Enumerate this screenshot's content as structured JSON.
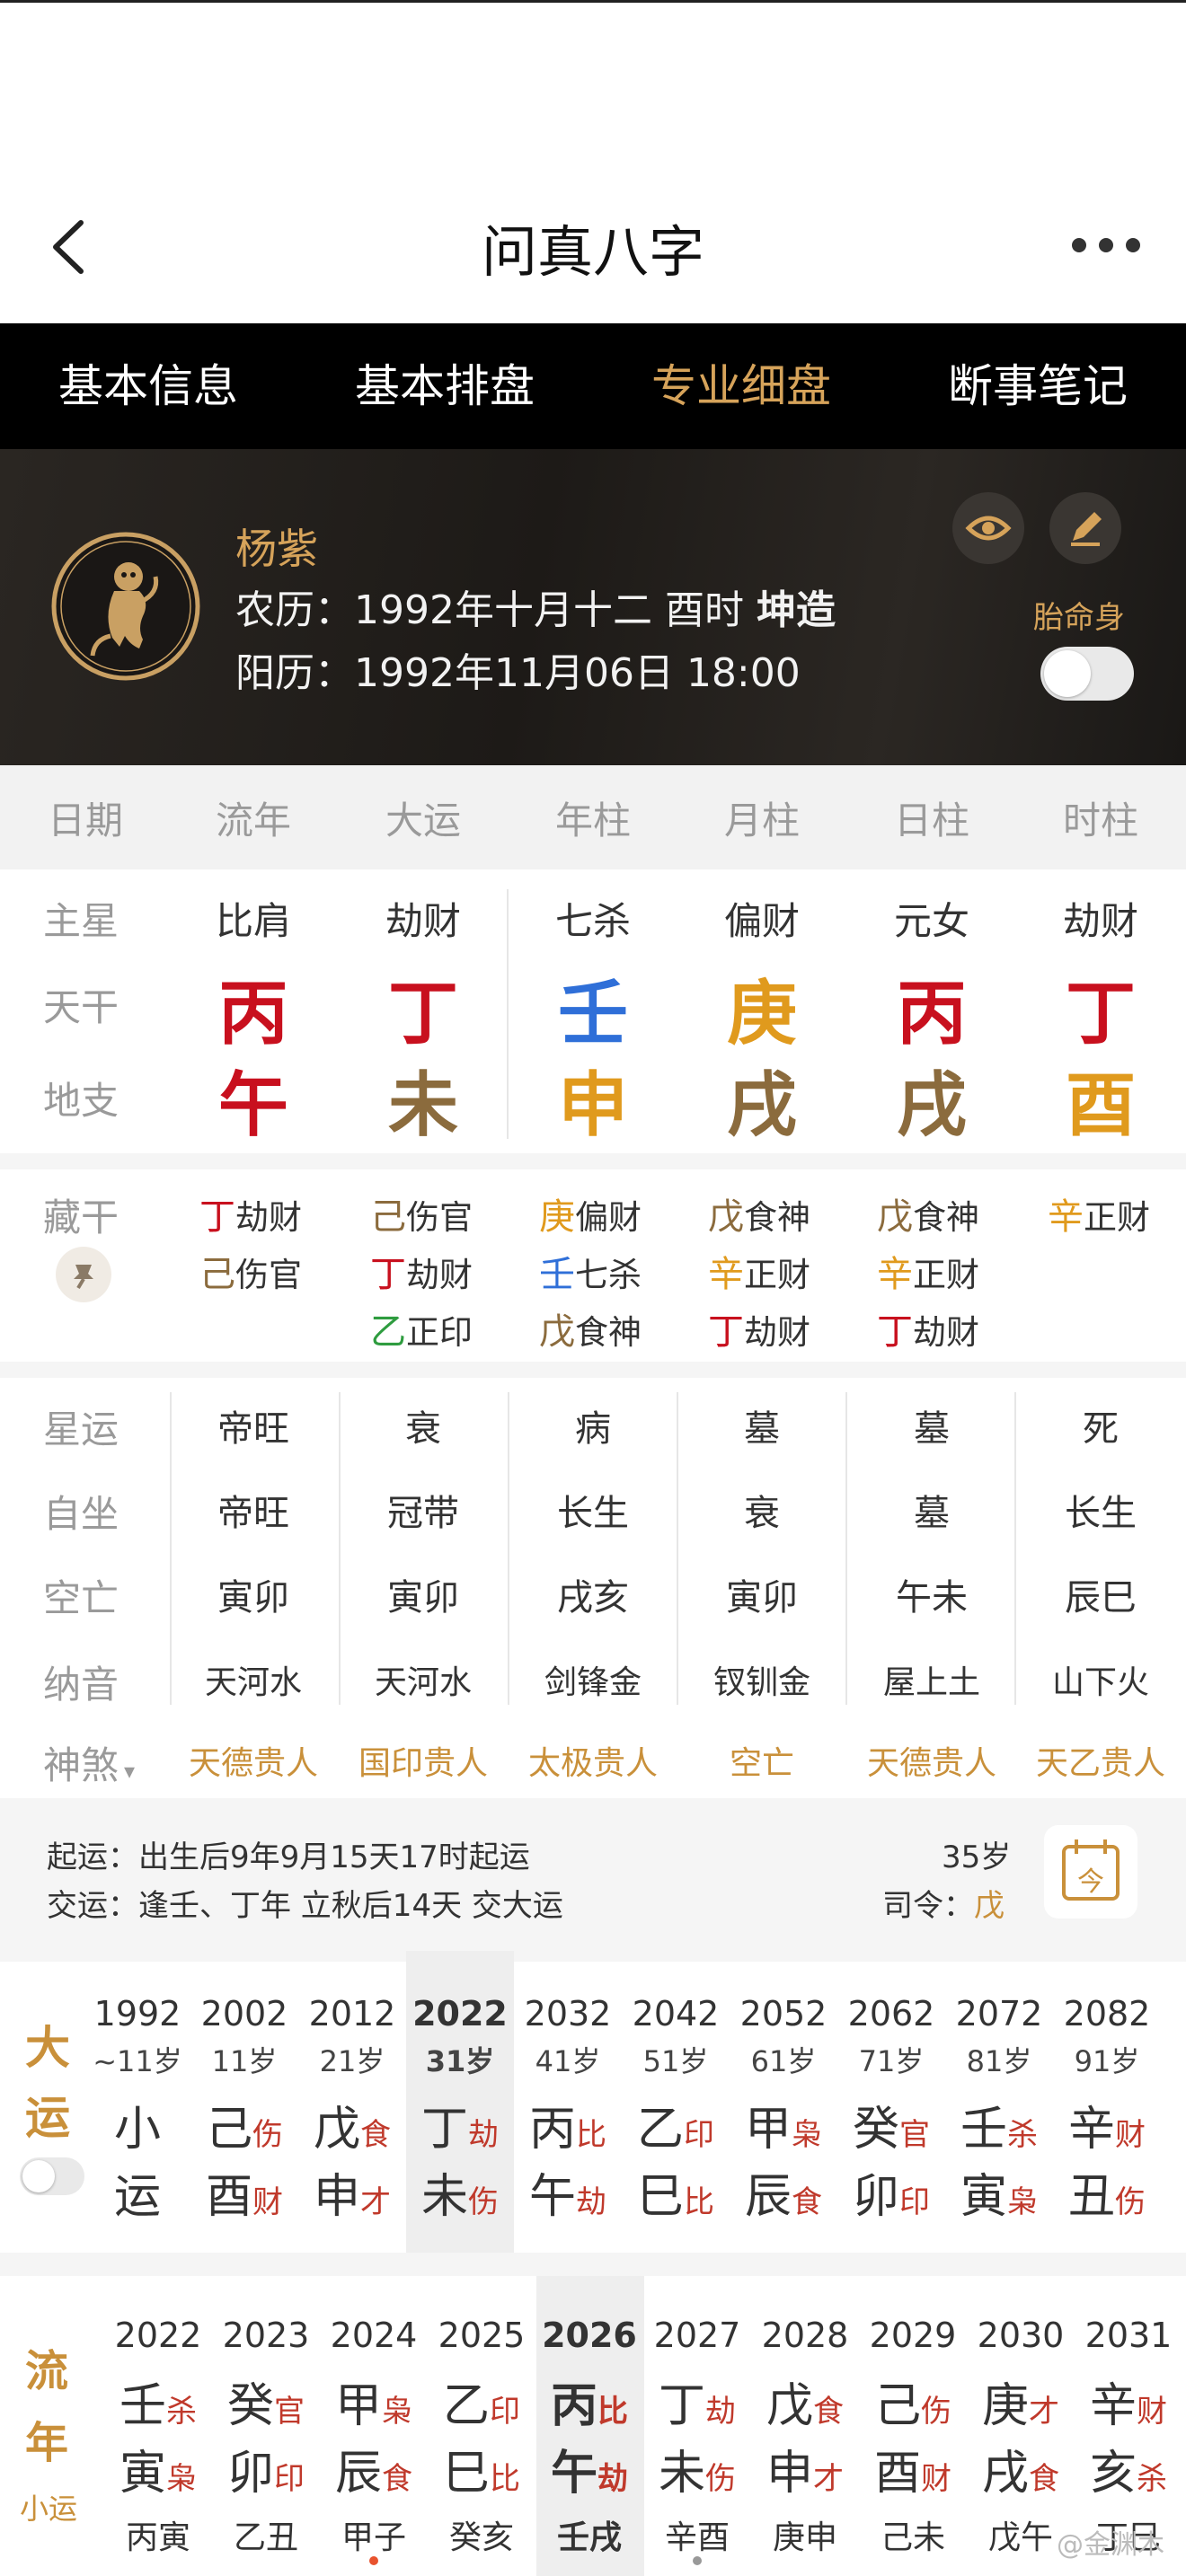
{
  "app": {
    "title": "问真八字"
  },
  "tabs": [
    {
      "label": "基本信息",
      "active": false
    },
    {
      "label": "基本排盘",
      "active": false
    },
    {
      "label": "专业细盘",
      "active": true
    },
    {
      "label": "断事笔记",
      "active": false
    }
  ],
  "profile": {
    "name": "杨紫",
    "lunar_prefix": "农历：1992年十月十二 酉时",
    "gender": "坤造",
    "solar": "阳历：1992年11月06日 18:00",
    "taiming_label": "胎命身",
    "taiming_on": false
  },
  "columns": [
    "日期",
    "流年",
    "大运",
    "年柱",
    "月柱",
    "日柱",
    "时柱"
  ],
  "row_labels": {
    "main_star": "主星",
    "stem": "天干",
    "branch": "地支",
    "hidden": "藏干",
    "star_luck": "星运",
    "self_seat": "自坐",
    "void": "空亡",
    "nayin": "纳音",
    "shensha": "神煞"
  },
  "main_stars": [
    "比肩",
    "劫财",
    "七杀",
    "偏财",
    "元女",
    "劫财"
  ],
  "stems": [
    {
      "char": "丙",
      "color": "#c8101e"
    },
    {
      "char": "丁",
      "color": "#c8101e"
    },
    {
      "char": "壬",
      "color": "#2f6fd8"
    },
    {
      "char": "庚",
      "color": "#e09a1d"
    },
    {
      "char": "丙",
      "color": "#c8101e"
    },
    {
      "char": "丁",
      "color": "#c8101e"
    }
  ],
  "branches": [
    {
      "char": "午",
      "color": "#c8101e"
    },
    {
      "char": "未",
      "color": "#8b6b3d"
    },
    {
      "char": "申",
      "color": "#e09a1d"
    },
    {
      "char": "戌",
      "color": "#8b6b3d"
    },
    {
      "char": "戌",
      "color": "#8b6b3d"
    },
    {
      "char": "酉",
      "color": "#e09a1d"
    }
  ],
  "hidden_stems": [
    [
      {
        "g": "丁",
        "color": "#c8101e",
        "t": "劫财"
      },
      {
        "g": "己",
        "color": "#8b6b3d",
        "t": "伤官"
      }
    ],
    [
      {
        "g": "己",
        "color": "#8b6b3d",
        "t": "伤官"
      },
      {
        "g": "丁",
        "color": "#c8101e",
        "t": "劫财"
      },
      {
        "g": "乙",
        "color": "#2e9c3f",
        "t": "正印"
      }
    ],
    [
      {
        "g": "庚",
        "color": "#e09a1d",
        "t": "偏财"
      },
      {
        "g": "壬",
        "color": "#2f6fd8",
        "t": "七杀"
      },
      {
        "g": "戊",
        "color": "#8b6b3d",
        "t": "食神"
      }
    ],
    [
      {
        "g": "戊",
        "color": "#8b6b3d",
        "t": "食神"
      },
      {
        "g": "辛",
        "color": "#e09a1d",
        "t": "正财"
      },
      {
        "g": "丁",
        "color": "#c8101e",
        "t": "劫财"
      }
    ],
    [
      {
        "g": "戊",
        "color": "#8b6b3d",
        "t": "食神"
      },
      {
        "g": "辛",
        "color": "#e09a1d",
        "t": "正财"
      },
      {
        "g": "丁",
        "color": "#c8101e",
        "t": "劫财"
      }
    ],
    [
      {
        "g": "辛",
        "color": "#e09a1d",
        "t": "正财"
      }
    ]
  ],
  "star_luck": [
    "帝旺",
    "衰",
    "病",
    "墓",
    "墓",
    "死"
  ],
  "self_seat": [
    "帝旺",
    "冠带",
    "长生",
    "衰",
    "墓",
    "长生"
  ],
  "void": [
    "寅卯",
    "寅卯",
    "戌亥",
    "寅卯",
    "午未",
    "辰巳"
  ],
  "nayin": [
    "天河水",
    "天河水",
    "剑锋金",
    "钗钏金",
    "屋上土",
    "山下火"
  ],
  "shensha": [
    "天德贵人",
    "国印贵人",
    "太极贵人",
    "空亡",
    "天德贵人",
    "天乙贵人"
  ],
  "info": {
    "qiyun": "起运：出生后9年9月15天17时起运",
    "jiaoyun": "交运：逢壬、丁年 立秋后14天 交大运",
    "age": "35岁",
    "siling_label": "司令：",
    "siling_value": "戊",
    "calendar_icon_char": "今"
  },
  "dayun": {
    "title_top": "大",
    "title_bottom": "运",
    "first": {
      "year": "1992",
      "age": "~11岁",
      "line1": "小",
      "line2": "运"
    },
    "items": [
      {
        "year": "2002",
        "age": "11岁",
        "s1": "己",
        "t1": "伤",
        "s2": "酉",
        "t2": "财",
        "selected": false
      },
      {
        "year": "2012",
        "age": "21岁",
        "s1": "戊",
        "t1": "食",
        "s2": "申",
        "t2": "才",
        "selected": false
      },
      {
        "year": "2022",
        "age": "31岁",
        "s1": "丁",
        "t1": "劫",
        "s2": "未",
        "t2": "伤",
        "selected": true
      },
      {
        "year": "2032",
        "age": "41岁",
        "s1": "丙",
        "t1": "比",
        "s2": "午",
        "t2": "劫",
        "selected": false
      },
      {
        "year": "2042",
        "age": "51岁",
        "s1": "乙",
        "t1": "印",
        "s2": "巳",
        "t2": "比",
        "selected": false
      },
      {
        "year": "2052",
        "age": "61岁",
        "s1": "甲",
        "t1": "枭",
        "s2": "辰",
        "t2": "食",
        "selected": false
      },
      {
        "year": "2062",
        "age": "71岁",
        "s1": "癸",
        "t1": "官",
        "s2": "卯",
        "t2": "印",
        "selected": false
      },
      {
        "year": "2072",
        "age": "81岁",
        "s1": "壬",
        "t1": "杀",
        "s2": "寅",
        "t2": "枭",
        "selected": false
      },
      {
        "year": "2082",
        "age": "91岁",
        "s1": "辛",
        "t1": "财",
        "s2": "丑",
        "t2": "伤",
        "selected": false
      }
    ]
  },
  "liunian": {
    "title_top": "流",
    "title_bottom": "年",
    "sub_label": "小运",
    "items": [
      {
        "year": "2022",
        "s1": "壬",
        "t1": "杀",
        "s2": "寅",
        "t2": "枭",
        "xy": "丙寅",
        "selected": false
      },
      {
        "year": "2023",
        "s1": "癸",
        "t1": "官",
        "s2": "卯",
        "t2": "印",
        "xy": "乙丑",
        "selected": false
      },
      {
        "year": "2024",
        "s1": "甲",
        "t1": "枭",
        "s2": "辰",
        "t2": "食",
        "xy": "甲子",
        "selected": false
      },
      {
        "year": "2025",
        "s1": "乙",
        "t1": "印",
        "s2": "巳",
        "t2": "比",
        "xy": "癸亥",
        "selected": false
      },
      {
        "year": "2026",
        "s1": "丙",
        "t1": "比",
        "s2": "午",
        "t2": "劫",
        "xy": "壬戌",
        "selected": true
      },
      {
        "year": "2027",
        "s1": "丁",
        "t1": "劫",
        "s2": "未",
        "t2": "伤",
        "xy": "辛酉",
        "selected": false
      },
      {
        "year": "2028",
        "s1": "戊",
        "t1": "食",
        "s2": "申",
        "t2": "才",
        "xy": "庚申",
        "selected": false
      },
      {
        "year": "2029",
        "s1": "己",
        "t1": "伤",
        "s2": "酉",
        "t2": "财",
        "xy": "己未",
        "selected": false
      },
      {
        "year": "2030",
        "s1": "庚",
        "t1": "才",
        "s2": "戌",
        "t2": "食",
        "xy": "戊午",
        "selected": false
      },
      {
        "year": "2031",
        "s1": "辛",
        "t1": "财",
        "s2": "亥",
        "t2": "杀",
        "xy": "丁巳",
        "selected": false
      }
    ]
  },
  "watermark": "@金渊木"
}
